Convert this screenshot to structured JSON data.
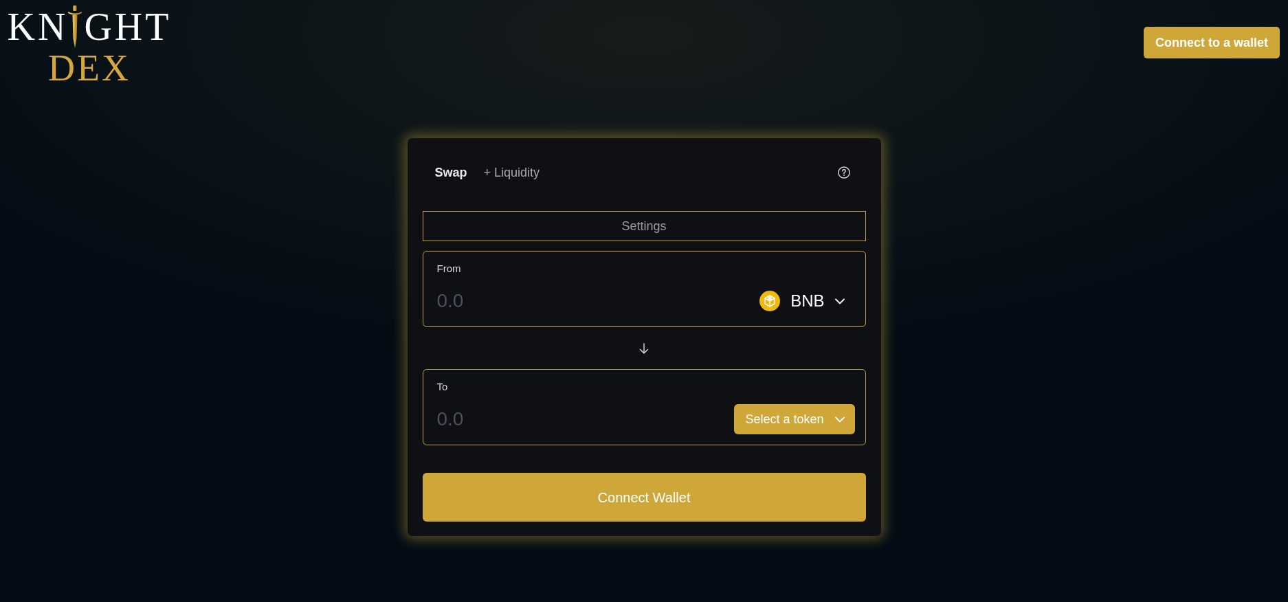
{
  "logo": {
    "word_start": "KN",
    "word_end": "GHT",
    "subtitle": "DEX"
  },
  "header": {
    "connect_button": "Connect to a wallet"
  },
  "swap_card": {
    "tabs": [
      {
        "label": "Swap",
        "selected": true
      },
      {
        "label": "+ Liquidity",
        "selected": false
      }
    ],
    "settings_button": "Settings",
    "from": {
      "label": "From",
      "placeholder": "0.0",
      "token": {
        "kind": "token",
        "symbol": "BNB"
      }
    },
    "to": {
      "label": "To",
      "placeholder": "0.0",
      "token": {
        "kind": "select",
        "label": "Select a token"
      }
    },
    "submit_button": "Connect Wallet"
  }
}
